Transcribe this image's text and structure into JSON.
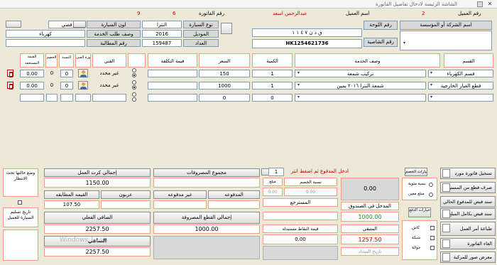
{
  "window": {
    "title": "الشاشة الرئيسة لادخال تفاصيل الفاتورة",
    "close_glyph": "✕"
  },
  "header": {
    "invoice_no_label": "رقم الفاتورة",
    "invoice_no_value": "9",
    "number_6": "6",
    "customer_name_label": "اسم العميل",
    "customer_name_value": "عبدالرحمن اسعد",
    "customer_no_label": "رقم العميل",
    "customer_no_value": "2",
    "company_or_institution_label": "اسم الشركة أو المؤسسة",
    "plate_label": "رقم اللوحة",
    "plate_value": "ق د ن ٧ ٤ ١ ١",
    "chassis_label": "رقم الشاصية",
    "chassis_value": "HK1254621736",
    "car_type_label": "نوع السيارة",
    "car_type_value": "النترا",
    "car_color_label": "لون السيارة",
    "car_color_value": "فضي",
    "model_label": "الموديل",
    "model_value": "2016",
    "meter_label": "العداد",
    "meter_value": "159487",
    "service_desc_label": "وصف طلب الخدمة",
    "service_desc_value": "كهرباء",
    "claim_no_label": "رقم المطالبة"
  },
  "table": {
    "headers": {
      "dept": "القسم",
      "service_desc": "وصف الخدمة",
      "qty": "الكمية",
      "price": "السعر",
      "cost": "قيمة التكلفة",
      "technician": "الفني",
      "tech_pic": "صورة الفني",
      "discount_pct": "النسبة",
      "discount_val": "الخصم",
      "net": "القيمة المستحقة"
    },
    "rows": [
      {
        "dept": "قسم الكهرباء",
        "service": "تركيب شمعة",
        "qty": "1",
        "price": "150",
        "cost": "",
        "tech": "غير محدد",
        "pct": "0",
        "disc": "0",
        "net": "0.00"
      },
      {
        "dept": "قطع الغيار الخارجية",
        "service": "شمعة النترا ٢٠١٦ يمين",
        "qty": "1",
        "price": "1000",
        "cost": "",
        "tech": "غير محدد",
        "pct": "0",
        "disc": "0",
        "net": "0.00"
      },
      {
        "dept": "",
        "service": "",
        "qty": "0",
        "price": "0",
        "cost": "",
        "tech": "",
        "pct": "",
        "disc": "",
        "net": ""
      }
    ]
  },
  "summary": {
    "expenses_total_label": "مجموع المصروفات",
    "labor_total_label": "إجمالي كرت العمل",
    "labor_total_value": "1150.00",
    "paid_label": "المدفوعه",
    "unpaid_label": "غير مدفوعه",
    "offer_label": "عربون",
    "matching_value_label": "القيمه المطابقه",
    "matching_value": "107.50",
    "parts_total_label": "إجمالي القطع المصروفة",
    "parts_total_value": "1000.00",
    "net_actual_label": "الصافي الفعلي",
    "net_actual_value": "2257.50",
    "net_label": "الصافي",
    "net_value": "2257.50",
    "returned_label": "المسترجع",
    "points_label": "قيمة النقاط مستبدلة",
    "points_value": "0.00",
    "discount_rate_label": "نسبة الخصم",
    "discount_amount_label": "مبلغ الخصم",
    "disc_val1": "0.00",
    "disc_val2": "0.00",
    "enter_paid_hint": "ادخل المدفوع ثم اضغط انتر",
    "paid_input_value": "1",
    "paid_box_value": "0.00",
    "fund_label": "المدخل في الصندوق",
    "fund_value": "1000.00",
    "remaining_label": "المتبقي",
    "remaining_value": "1257.50",
    "pay_date_label": "تاريخ السداد",
    "customer_discount_options": "خيارات الخصم",
    "pct_option": "نسبة مئوية",
    "amount_option": "مبلغ معين",
    "payment_options": "خيارات الدفع",
    "cash_option": "كاش",
    "network_option": "شبكة",
    "transfer_option": "حوالة",
    "watermark": "Windows تنشيط"
  },
  "left_panel": {
    "status_label": "وضع حالتها تحت الانتظار",
    "delivery_date_label": "تاريخ تسليم السيارة للعميل"
  },
  "sidebar": {
    "btn1": "تسجيل فاتورة مورد",
    "btn2": "صرف قطع من المستودع",
    "btn3": "سند قبض للمدفوع الحالي",
    "btn4": "سند قبض بكامل المبلغ",
    "btn5": "طباعة أمر العمل",
    "btn6": "الغاء الفاتورة",
    "btn7": "معرض صور للمركبة"
  }
}
